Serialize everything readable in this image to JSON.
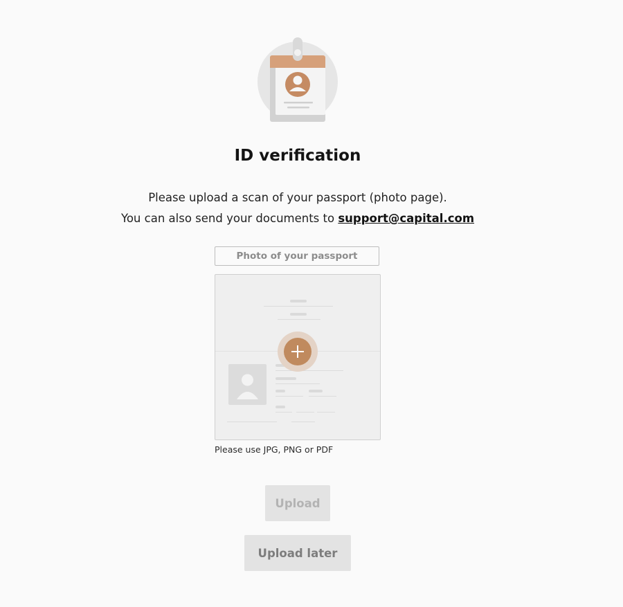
{
  "header": {
    "title": "ID verification",
    "description_line1": "Please upload a scan of your passport (photo page).",
    "description_line2_prefix": "You can also send your documents to",
    "support_email": "support@capital.com"
  },
  "upload": {
    "document_label": "Photo of your passport",
    "add_icon": "plus-icon",
    "formats_hint": "Please use JPG, PNG or PDF"
  },
  "actions": {
    "upload_label": "Upload",
    "upload_later_label": "Upload later"
  },
  "colors": {
    "accent": "#c08a5e",
    "button_bg": "#e3e3e3",
    "background": "#fafafa"
  }
}
